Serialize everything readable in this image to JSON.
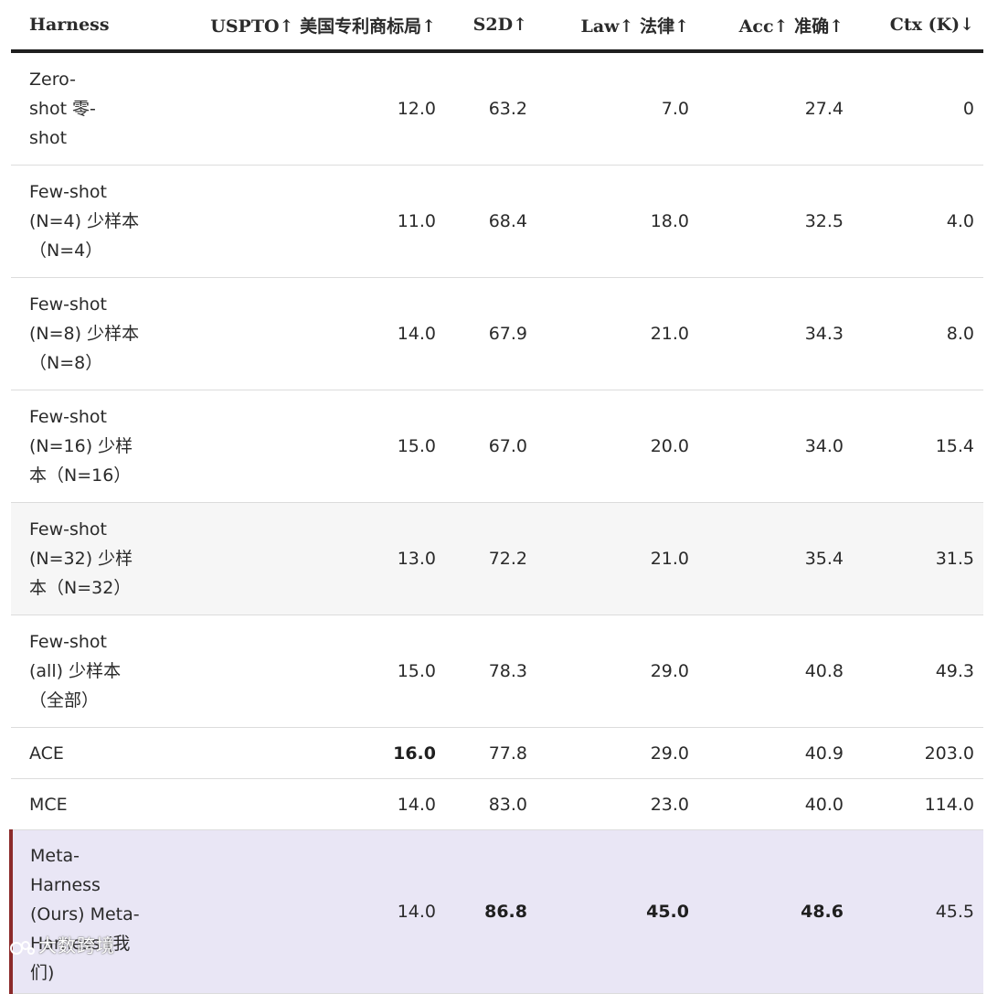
{
  "table": {
    "headers": {
      "harness": "Harness",
      "uspto": "USPTO↑ 美国专利商标局↑",
      "s2d": "S2D↑",
      "law": "Law↑ 法律↑",
      "acc": "Acc↑ 准确↑",
      "ctx": "Ctx (K)↓"
    },
    "rows": [
      {
        "name": "Zero-shot 零-shot",
        "uspto": "12.0",
        "s2d": "63.2",
        "law": "7.0",
        "acc": "27.4",
        "ctx": "0"
      },
      {
        "name": "Few-shot (N=4) 少样本（N=4）",
        "uspto": "11.0",
        "s2d": "68.4",
        "law": "18.0",
        "acc": "32.5",
        "ctx": "4.0"
      },
      {
        "name": "Few-shot (N=8) 少样本（N=8）",
        "uspto": "14.0",
        "s2d": "67.9",
        "law": "21.0",
        "acc": "34.3",
        "ctx": "8.0"
      },
      {
        "name": "Few-shot (N=16) 少样本（N=16）",
        "uspto": "15.0",
        "s2d": "67.0",
        "law": "20.0",
        "acc": "34.0",
        "ctx": "15.4"
      },
      {
        "name": "Few-shot (N=32) 少样本（N=32）",
        "uspto": "13.0",
        "s2d": "72.2",
        "law": "21.0",
        "acc": "35.4",
        "ctx": "31.5"
      },
      {
        "name": "Few-shot (all) 少样本（全部）",
        "uspto": "15.0",
        "s2d": "78.3",
        "law": "29.0",
        "acc": "40.8",
        "ctx": "49.3"
      },
      {
        "name": "ACE",
        "uspto": "16.0",
        "s2d": "77.8",
        "law": "29.0",
        "acc": "40.9",
        "ctx": "203.0"
      },
      {
        "name": "MCE",
        "uspto": "14.0",
        "s2d": "83.0",
        "law": "23.0",
        "acc": "40.0",
        "ctx": "114.0"
      },
      {
        "name": "Meta-Harness (Ours) Meta-Harness (我们)",
        "uspto": "14.0",
        "s2d": "86.8",
        "law": "45.0",
        "acc": "48.6",
        "ctx": "45.5"
      }
    ]
  },
  "watermark": "大数跨境",
  "colors": {
    "highlight_row_bg": "#e9e6f5",
    "highlight_row_accent": "#8b2a2a",
    "alt_row_bg": "#f6f6f6",
    "header_rule": "#1f1f1f"
  }
}
